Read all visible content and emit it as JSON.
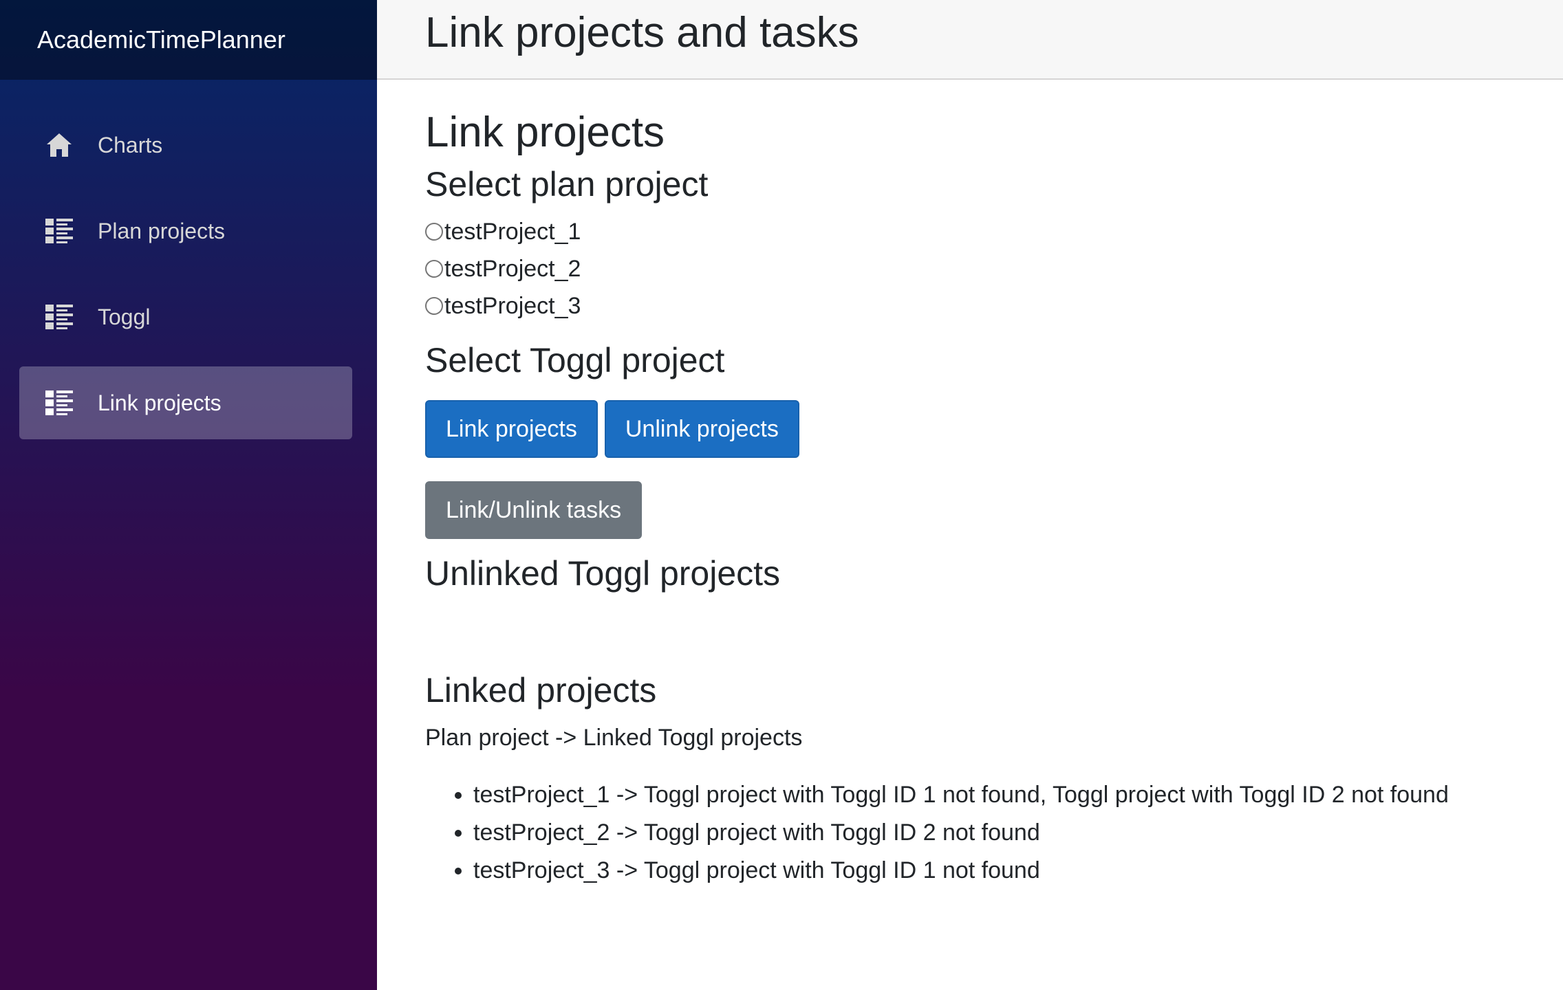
{
  "sidebar": {
    "brand": "AcademicTimePlanner",
    "items": [
      {
        "label": "Charts",
        "icon": "home-icon",
        "active": false
      },
      {
        "label": "Plan projects",
        "icon": "list-icon",
        "active": false
      },
      {
        "label": "Toggl",
        "icon": "list-icon",
        "active": false
      },
      {
        "label": "Link projects",
        "icon": "list-icon",
        "active": true
      }
    ]
  },
  "header": {
    "title": "Link projects and tasks"
  },
  "main": {
    "heading": "Link projects",
    "plan_section": {
      "title": "Select plan project",
      "options": [
        "testProject_1",
        "testProject_2",
        "testProject_3"
      ]
    },
    "toggl_section": {
      "title": "Select Toggl project"
    },
    "buttons": {
      "link": "Link projects",
      "unlink": "Unlink projects",
      "tasks": "Link/Unlink tasks"
    },
    "unlinked": {
      "title": "Unlinked Toggl projects"
    },
    "linked": {
      "title": "Linked projects",
      "caption": "Plan project -> Linked Toggl projects",
      "items": [
        "testProject_1 -> Toggl project with Toggl ID 1 not found, Toggl project with Toggl ID 2 not found",
        "testProject_2 -> Toggl project with Toggl ID 2 not found",
        "testProject_3 -> Toggl project with Toggl ID 1 not found"
      ]
    }
  },
  "colors": {
    "primary": "#1b6ec2",
    "secondary": "#6c757d",
    "sidebar_top": "#052767",
    "sidebar_bottom": "#3a0647"
  }
}
